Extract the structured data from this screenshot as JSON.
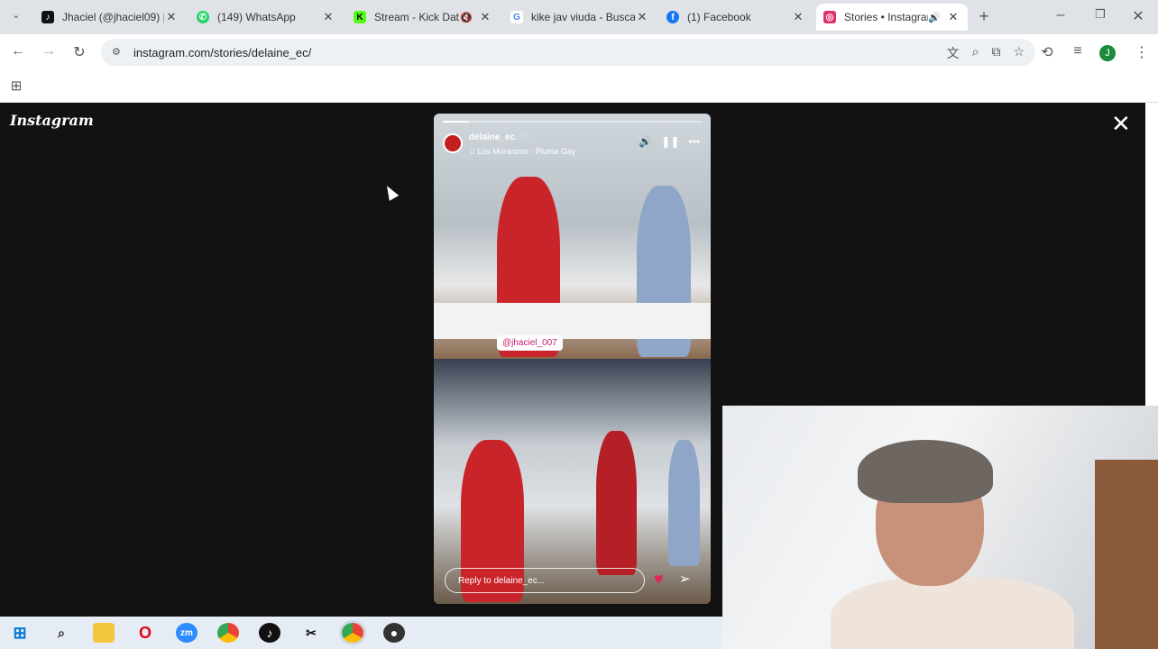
{
  "browser": {
    "tabs": [
      {
        "title": "Jhaciel (@jhaciel09) |",
        "favicon": "tiktok-icon",
        "color": "#111111",
        "active": false
      },
      {
        "title": "(149) WhatsApp",
        "favicon": "whatsapp-icon",
        "color": "#25d366",
        "active": false
      },
      {
        "title": "Stream - Kick Dat",
        "favicon": "kick-icon",
        "color": "#53fc18",
        "active": false,
        "muted": true
      },
      {
        "title": "kike jav viuda - Busca",
        "favicon": "google-icon",
        "color": "#4285f4",
        "active": false
      },
      {
        "title": "(1) Facebook",
        "favicon": "facebook-icon",
        "color": "#1877f2",
        "active": false
      },
      {
        "title": "Stories • Instagram",
        "favicon": "instagram-icon",
        "color": "#e1306c",
        "active": true,
        "audio": true
      }
    ],
    "url": "instagram.com/stories/delaine_ec/",
    "new_tab": "+"
  },
  "instagram": {
    "logo": "Instagram",
    "close": "✕",
    "story": {
      "username": "delaine_ec",
      "time": "1h",
      "music": "Los Morancos - Pluma Gay",
      "mention": "@jhaciel_007",
      "reply_placeholder": "Reply to delaine_ec...",
      "progress": 0.1
    }
  },
  "taskbar": {
    "items": [
      "windows-icon",
      "search-icon",
      "file-explorer-icon",
      "opera-icon",
      "zoom-icon",
      "chrome-icon",
      "tiktok-icon",
      "capcut-icon",
      "chrome-profile-icon",
      "obs-icon"
    ]
  },
  "colors": {
    "accent": "#e1306c",
    "heart": "#e0245e"
  }
}
